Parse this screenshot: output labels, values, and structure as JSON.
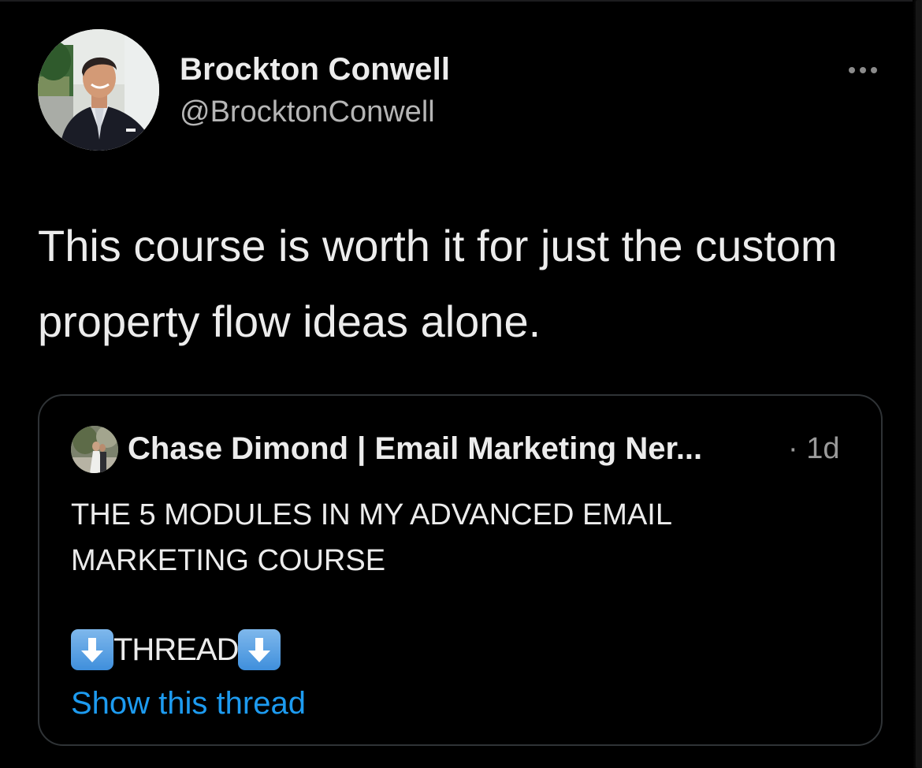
{
  "tweet": {
    "author_name": "Brockton Conwell",
    "author_handle": "@BrocktonConwell",
    "avatar_icon": "profile-photo",
    "more_icon": "more-horizontal-icon",
    "text": "This course is worth it for just the custom property flow ideas alone."
  },
  "quoted_tweet": {
    "author_name": "Chase Dimond | Email Marketing Ner...",
    "time": "· 1d",
    "body_lines": [
      "THE 5 MODULES IN MY ADVANCED EMAIL",
      "MARKETING COURSE"
    ],
    "thread_label": "THREAD",
    "thread_icon": "down-arrow-emoji",
    "show_thread": "Show this thread"
  },
  "colors": {
    "background": "#000000",
    "text": "#ececec",
    "secondary": "#b5b5b5",
    "link": "#1d9bf0",
    "card_border": "#2f3336"
  }
}
